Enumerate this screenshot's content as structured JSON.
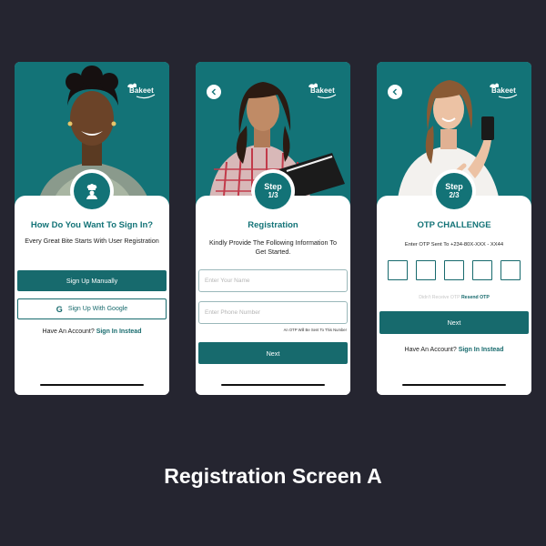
{
  "brand": {
    "logo_text": "Bakeet",
    "accent": "#137377",
    "button_color": "#176a6d",
    "background": "#252530"
  },
  "screen1": {
    "title": "How Do You Want To Sign In?",
    "subtitle": "Every Great Bite Starts With User Registration",
    "badge_icon": "chef-icon",
    "btn_manual": "Sign Up Manually",
    "btn_google": "Sign Up With Google",
    "have_account": "Have An Account?",
    "sign_in": "Sign In Instead"
  },
  "screen2": {
    "badge_step": "Step",
    "badge_num": "1/3",
    "title": "Registration",
    "subtitle": "Kindly Provide The Following Information To Get Started.",
    "name_placeholder": "Enter Your Name",
    "phone_placeholder": "Enter Phone Number",
    "otp_hint": "An OTP Will Be Sent To This Number",
    "btn_next": "Next"
  },
  "screen3": {
    "badge_step": "Step",
    "badge_num": "2/3",
    "title": "OTP CHALLENGE",
    "subtitle": "Enter OTP Sent To +234-80X-XXX - XX44",
    "didnt_receive": "Didn't Receive OTP",
    "resend": "Resend OTP",
    "btn_next": "Next",
    "have_account": "Have An Account?",
    "sign_in": "Sign In Instead"
  },
  "caption": "Registration Screen A"
}
